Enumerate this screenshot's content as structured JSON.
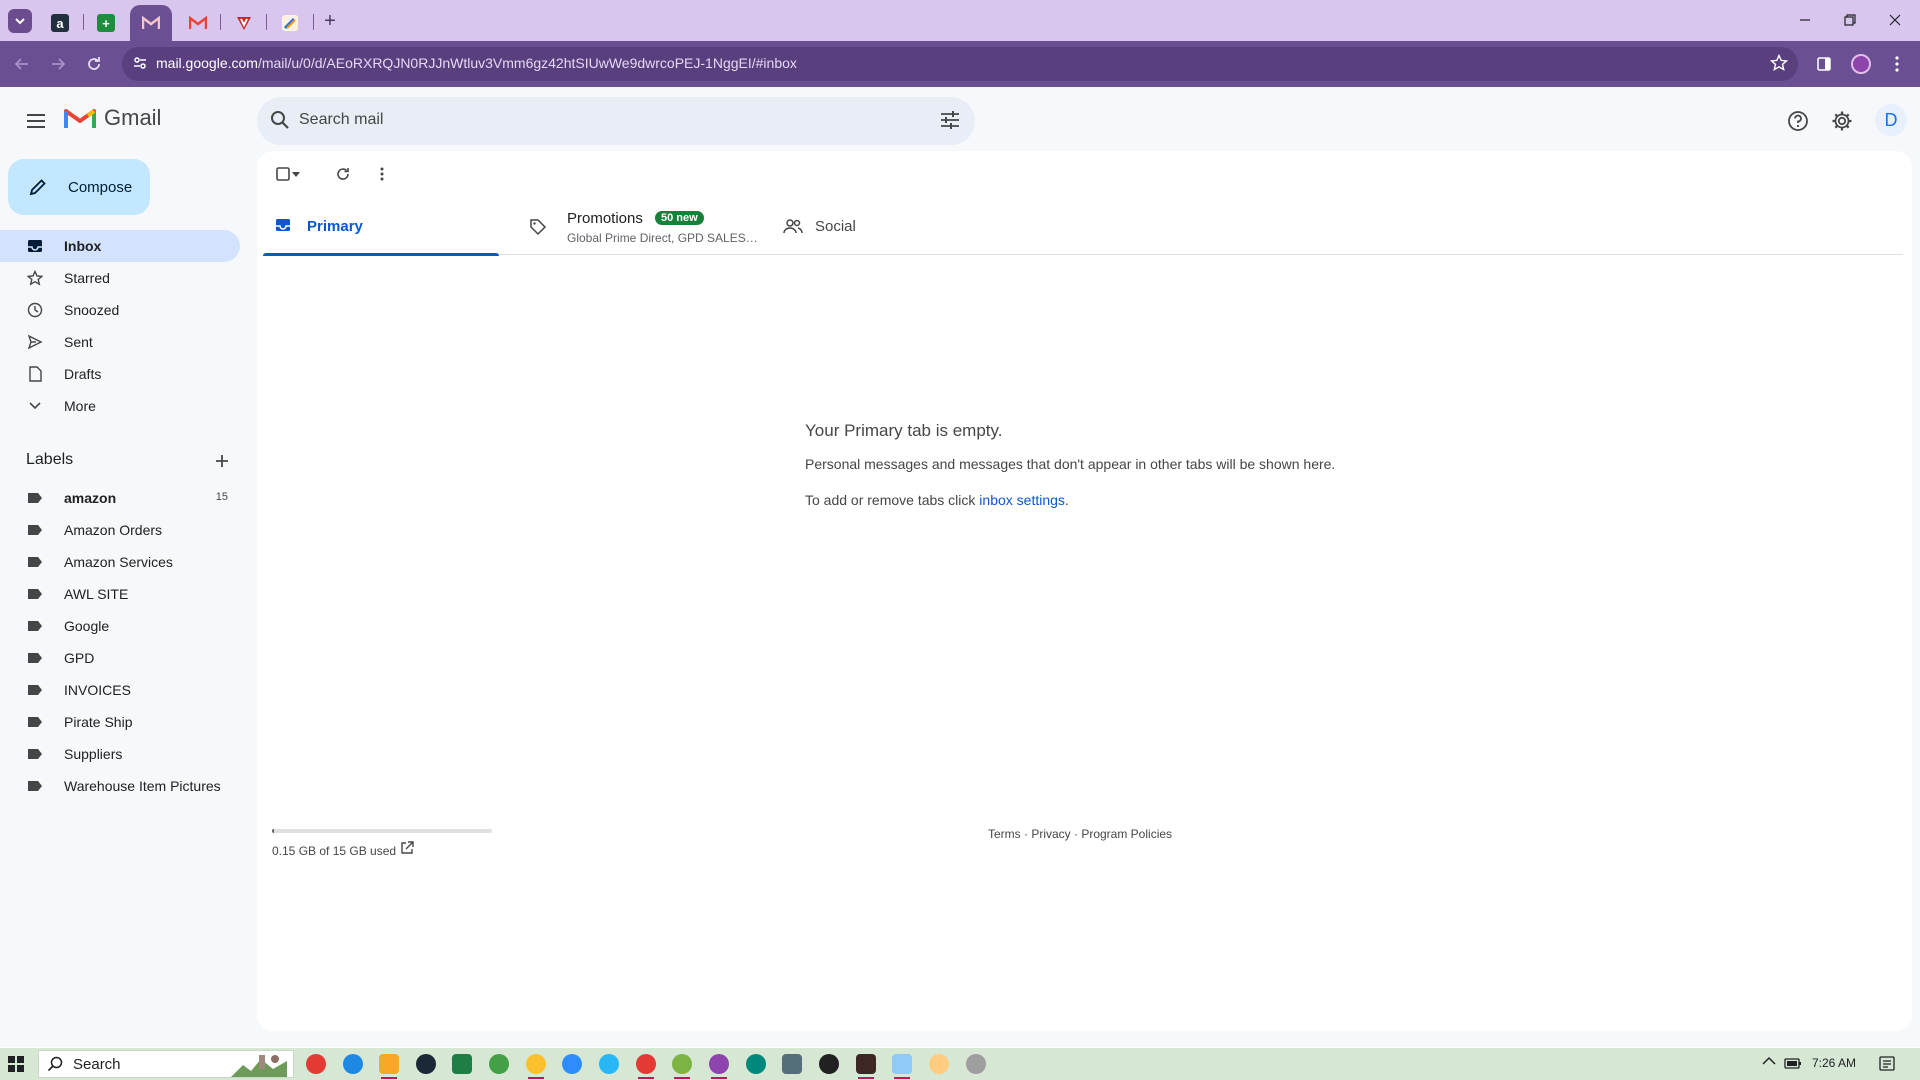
{
  "browser": {
    "tabs": [
      {
        "name": "Amazon"
      },
      {
        "name": "Google Sheets"
      },
      {
        "name": "Gmail",
        "active": true
      },
      {
        "name": "Gmail"
      },
      {
        "name": "Vivaldi"
      },
      {
        "name": "Pencil"
      }
    ],
    "new_tab": "+",
    "url_host": "mail.google.com",
    "url_path": "/mail/u/0/d/AEoRXRQJN0RJJnWtluv3Vmm6gz42htSIUwWe9dwrcoPEJ-1NggEI/#inbox"
  },
  "gmail": {
    "logo_text": "Gmail",
    "search_placeholder": "Search mail",
    "avatar_letter": "D",
    "compose_label": "Compose",
    "nav": [
      {
        "label": "Inbox",
        "icon": "inbox-icon",
        "active": true
      },
      {
        "label": "Starred",
        "icon": "star-icon"
      },
      {
        "label": "Snoozed",
        "icon": "clock-icon"
      },
      {
        "label": "Sent",
        "icon": "send-icon"
      },
      {
        "label": "Drafts",
        "icon": "draft-icon"
      },
      {
        "label": "More",
        "icon": "chevron-down-icon"
      }
    ],
    "labels_heading": "Labels",
    "labels": [
      {
        "name": "amazon",
        "count": "15",
        "bold": true
      },
      {
        "name": "Amazon Orders"
      },
      {
        "name": "Amazon Services"
      },
      {
        "name": "AWL SITE"
      },
      {
        "name": "Google"
      },
      {
        "name": "GPD"
      },
      {
        "name": "INVOICES"
      },
      {
        "name": "Pirate Ship"
      },
      {
        "name": "Suppliers"
      },
      {
        "name": "Warehouse Item Pictures"
      }
    ],
    "tabs": {
      "primary": "Primary",
      "promotions": "Promotions",
      "promotions_badge": "50 new",
      "promotions_sub": "Global Prime Direct, GPD SALES…",
      "social": "Social"
    },
    "empty": {
      "title": "Your Primary tab is empty.",
      "line1": "Personal messages and messages that don't appear in other tabs will be shown here.",
      "line2_prefix": "To add or remove tabs click ",
      "line2_link": "inbox settings",
      "line2_suffix": "."
    },
    "storage": {
      "text": "0.15 GB of 15 GB used",
      "fraction": 0.01
    },
    "footer": "Terms · Privacy · Program Policies"
  },
  "taskbar": {
    "search_label": "Search",
    "clock": "7:26 AM"
  },
  "colors": {
    "tabstrip": "#d8c6ee",
    "toolbar": "#6b4f93",
    "compose": "#c2e7ff",
    "active_nav": "#d3e3fd",
    "accent": "#0b57d0",
    "badge": "#188038"
  }
}
